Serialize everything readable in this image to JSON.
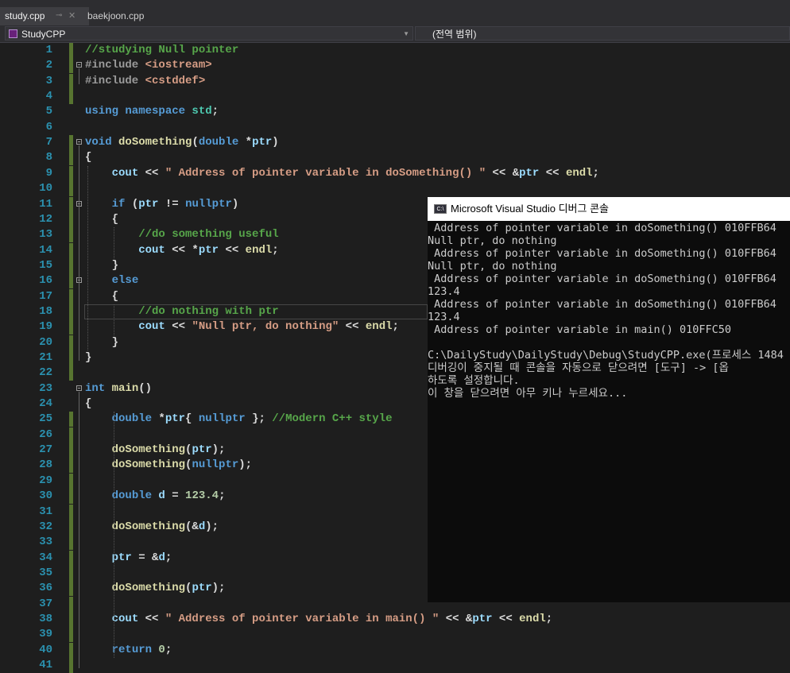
{
  "tabs": [
    {
      "label": "study.cpp",
      "active": true
    },
    {
      "label": "baekjoon.cpp",
      "active": false
    }
  ],
  "nav": {
    "project": "StudyCPP",
    "scope": "(전역 범위)"
  },
  "code_lines": [
    [
      [
        "c",
        "//studying Null pointer"
      ]
    ],
    [
      [
        "p",
        "#include "
      ],
      [
        "s",
        "<iostream>"
      ]
    ],
    [
      [
        "p",
        "#include "
      ],
      [
        "s",
        "<cstddef>"
      ]
    ],
    [],
    [
      [
        "k",
        "using namespace "
      ],
      [
        "t",
        "std"
      ],
      [
        "m",
        ";"
      ]
    ],
    [],
    [
      [
        "k",
        "void "
      ],
      [
        "f",
        "doSomething"
      ],
      [
        "m",
        "("
      ],
      [
        "k",
        "double "
      ],
      [
        "m",
        "*"
      ],
      [
        "i",
        "ptr"
      ],
      [
        "m",
        ")"
      ]
    ],
    [
      [
        "m",
        "{"
      ]
    ],
    [
      [
        "m",
        "    "
      ],
      [
        "i",
        "cout"
      ],
      [
        "m",
        " << "
      ],
      [
        "s",
        "\" Address of pointer variable in doSomething() \""
      ],
      [
        "m",
        " << &"
      ],
      [
        "i",
        "ptr"
      ],
      [
        "m",
        " << "
      ],
      [
        "f",
        "endl"
      ],
      [
        "m",
        ";"
      ]
    ],
    [],
    [
      [
        "m",
        "    "
      ],
      [
        "k",
        "if "
      ],
      [
        "m",
        "("
      ],
      [
        "i",
        "ptr"
      ],
      [
        "m",
        " != "
      ],
      [
        "k",
        "nullptr"
      ],
      [
        "m",
        ")"
      ]
    ],
    [
      [
        "m",
        "    {"
      ]
    ],
    [
      [
        "m",
        "        "
      ],
      [
        "c",
        "//do something useful"
      ]
    ],
    [
      [
        "m",
        "        "
      ],
      [
        "i",
        "cout"
      ],
      [
        "m",
        " << *"
      ],
      [
        "i",
        "ptr"
      ],
      [
        "m",
        " << "
      ],
      [
        "f",
        "endl"
      ],
      [
        "m",
        ";"
      ]
    ],
    [
      [
        "m",
        "    }"
      ]
    ],
    [
      [
        "m",
        "    "
      ],
      [
        "k",
        "else"
      ]
    ],
    [
      [
        "m",
        "    {"
      ]
    ],
    [
      [
        "m",
        "        "
      ],
      [
        "c",
        "//do nothing with ptr"
      ]
    ],
    [
      [
        "m",
        "        "
      ],
      [
        "i",
        "cout"
      ],
      [
        "m",
        " << "
      ],
      [
        "s",
        "\"Null ptr, do nothing\""
      ],
      [
        "m",
        " << "
      ],
      [
        "f",
        "endl"
      ],
      [
        "m",
        ";"
      ]
    ],
    [
      [
        "m",
        "    }"
      ]
    ],
    [
      [
        "m",
        "}"
      ]
    ],
    [],
    [
      [
        "k",
        "int "
      ],
      [
        "f",
        "main"
      ],
      [
        "m",
        "()"
      ]
    ],
    [
      [
        "m",
        "{"
      ]
    ],
    [
      [
        "m",
        "    "
      ],
      [
        "k",
        "double "
      ],
      [
        "m",
        "*"
      ],
      [
        "i",
        "ptr"
      ],
      [
        "m",
        "{ "
      ],
      [
        "k",
        "nullptr"
      ],
      [
        "m",
        " }; "
      ],
      [
        "c",
        "//Modern C++ style"
      ]
    ],
    [],
    [
      [
        "m",
        "    "
      ],
      [
        "f",
        "doSomething"
      ],
      [
        "m",
        "("
      ],
      [
        "i",
        "ptr"
      ],
      [
        "m",
        ");"
      ]
    ],
    [
      [
        "m",
        "    "
      ],
      [
        "f",
        "doSomething"
      ],
      [
        "m",
        "("
      ],
      [
        "k",
        "nullptr"
      ],
      [
        "m",
        ");"
      ]
    ],
    [],
    [
      [
        "m",
        "    "
      ],
      [
        "k",
        "double "
      ],
      [
        "i",
        "d"
      ],
      [
        "m",
        " = "
      ],
      [
        "n",
        "123.4"
      ],
      [
        "m",
        ";"
      ]
    ],
    [],
    [
      [
        "m",
        "    "
      ],
      [
        "f",
        "doSomething"
      ],
      [
        "m",
        "(&"
      ],
      [
        "i",
        "d"
      ],
      [
        "m",
        ");"
      ]
    ],
    [],
    [
      [
        "m",
        "    "
      ],
      [
        "i",
        "ptr"
      ],
      [
        "m",
        " = &"
      ],
      [
        "i",
        "d"
      ],
      [
        "m",
        ";"
      ]
    ],
    [],
    [
      [
        "m",
        "    "
      ],
      [
        "f",
        "doSomething"
      ],
      [
        "m",
        "("
      ],
      [
        "i",
        "ptr"
      ],
      [
        "m",
        ");"
      ]
    ],
    [],
    [
      [
        "m",
        "    "
      ],
      [
        "i",
        "cout"
      ],
      [
        "m",
        " << "
      ],
      [
        "s",
        "\" Address of pointer variable in main() \""
      ],
      [
        "m",
        " << &"
      ],
      [
        "i",
        "ptr"
      ],
      [
        "m",
        " << "
      ],
      [
        "f",
        "endl"
      ],
      [
        "m",
        ";"
      ]
    ],
    [],
    [
      [
        "m",
        "    "
      ],
      [
        "k",
        "return "
      ],
      [
        "n",
        "0"
      ],
      [
        "m",
        ";"
      ]
    ],
    []
  ],
  "console": {
    "title": "Microsoft Visual Studio 디버그 콘솔",
    "icon_text": "C:\\",
    "lines": [
      " Address of pointer variable in doSomething() 010FFB64",
      "Null ptr, do nothing",
      " Address of pointer variable in doSomething() 010FFB64",
      "Null ptr, do nothing",
      " Address of pointer variable in doSomething() 010FFB64",
      "123.4",
      " Address of pointer variable in doSomething() 010FFB64",
      "123.4",
      " Address of pointer variable in main() 010FFC50",
      "",
      "C:\\DailyStudy\\DailyStudy\\Debug\\StudyCPP.exe(프로세스 1484",
      "디버깅이 중지될 때 콘솔을 자동으로 닫으려면 [도구] -> [옵",
      "하도록 설정합니다.",
      "이 창을 닫으려면 아무 키나 누르세요..."
    ]
  },
  "colors": {
    "background": "#1e1e1e",
    "keyword": "#569cd6",
    "function": "#dcdcaa",
    "string": "#d69d85",
    "comment": "#57a64a",
    "number": "#b5cea8",
    "identifier": "#9cdcfe",
    "type": "#4ec9b0",
    "line_number": "#2b91af",
    "change_bar": "#577430"
  }
}
